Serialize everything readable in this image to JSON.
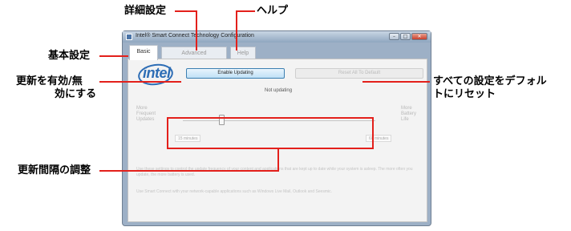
{
  "window": {
    "title": "Intel® Smart Connect Technology Configuration",
    "controls": {
      "minimize": "–",
      "maximize": "□",
      "close": "✕"
    }
  },
  "tabs": [
    {
      "label": "Basic",
      "active": true
    },
    {
      "label": "Advanced",
      "active": false
    },
    {
      "label": "Help",
      "active": false
    }
  ],
  "logo": {
    "text": "intel",
    "color": "#2d6db5"
  },
  "buttons": {
    "enable_updating": "Enable Updating",
    "reset_all_to_default": "Reset All To Default"
  },
  "status_text": "Not updating",
  "slider": {
    "left_label": [
      "More",
      "Frequent",
      "Updates"
    ],
    "right_label": [
      "More",
      "Battery",
      "Life"
    ],
    "min_label": "15 minutes",
    "max_label": "60 minutes",
    "value_fraction": 0.2
  },
  "help_paragraphs": {
    "p1": "Use these settings to control the update frequency of your content and applications that are kept up to date while your system is asleep. The more often you update, the more battery is used.",
    "p2": "Use Smart Connect with your network-capable applications such as Windows Live Mail, Outlook and Seesmic."
  },
  "callouts": {
    "advanced_settings": "詳細設定",
    "help": "ヘルプ",
    "basic_settings": "基本設定",
    "enable_disable_line1": "更新を有効/無",
    "enable_disable_line2": "効にする",
    "reset_line1": "すべての設定をデフォル",
    "reset_line2": "トにリセット",
    "interval": "更新間隔の調整"
  },
  "colors": {
    "callout_line": "#e3201b",
    "intel_blue": "#2d6db5",
    "primary_button_border": "#3c7fb1"
  }
}
